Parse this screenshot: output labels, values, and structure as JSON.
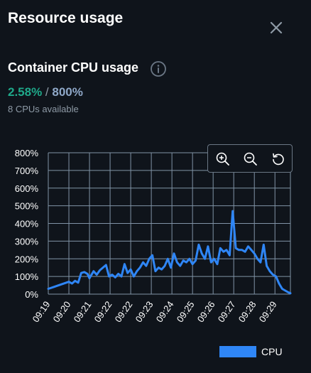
{
  "panel": {
    "title": "Resource usage"
  },
  "section": {
    "title": "Container CPU usage",
    "current_usage": "2.58%",
    "separator": " / ",
    "max_usage": "800%",
    "cpus_available": "8 CPUs available"
  },
  "icons": {
    "close": "close-icon",
    "info": "info-icon",
    "zoom_in": "zoom-in-icon",
    "zoom_out": "zoom-out-icon",
    "reset": "reset-zoom-icon"
  },
  "colors": {
    "background": "#0f141b",
    "series": "#2f86f6",
    "current_value": "#1fa98a",
    "grid": "#8093a6"
  },
  "chart_data": {
    "type": "line",
    "title": "",
    "xlabel": "",
    "ylabel": "",
    "ylim": [
      0,
      800
    ],
    "y_ticks": [
      "800%",
      "700%",
      "600%",
      "500%",
      "400%",
      "300%",
      "200%",
      "100%",
      "0%"
    ],
    "x_ticks": [
      "09:19",
      "09:20",
      "09:21",
      "09:22",
      "09:22",
      "09:23",
      "09:24",
      "09:25",
      "09:26",
      "09:27",
      "09:28",
      "09:29"
    ],
    "grid": true,
    "legend_position": "bottom-right",
    "series": [
      {
        "name": "CPU",
        "color": "#2f86f6",
        "x": [
          0.0,
          0.25,
          0.5,
          0.75,
          1.0,
          1.15,
          1.3,
          1.45,
          1.6,
          1.75,
          1.9,
          2.0,
          2.2,
          2.35,
          2.5,
          2.65,
          2.8,
          2.95,
          3.1,
          3.25,
          3.4,
          3.55,
          3.7,
          3.85,
          4.0,
          4.15,
          4.3,
          4.45,
          4.6,
          4.75,
          4.9,
          5.05,
          5.2,
          5.35,
          5.5,
          5.65,
          5.8,
          5.95,
          6.1,
          6.25,
          6.4,
          6.55,
          6.7,
          6.85,
          7.0,
          7.15,
          7.3,
          7.45,
          7.6,
          7.75,
          7.9,
          8.05,
          8.2,
          8.35,
          8.5,
          8.65,
          8.8,
          8.95,
          9.1,
          9.25,
          9.4,
          9.55,
          9.7,
          9.85,
          10.0,
          10.15,
          10.3,
          10.45,
          10.6,
          10.75,
          10.9,
          11.05,
          11.2,
          11.35,
          11.5,
          11.65,
          11.75
        ],
        "y": [
          30,
          40,
          50,
          60,
          70,
          60,
          75,
          65,
          120,
          125,
          115,
          90,
          130,
          110,
          135,
          150,
          165,
          100,
          110,
          95,
          115,
          100,
          170,
          120,
          140,
          100,
          130,
          150,
          180,
          160,
          200,
          220,
          130,
          150,
          140,
          160,
          200,
          150,
          230,
          180,
          160,
          190,
          180,
          200,
          170,
          190,
          280,
          230,
          200,
          270,
          180,
          200,
          170,
          260,
          240,
          250,
          220,
          470,
          260,
          250,
          250,
          240,
          270,
          250,
          230,
          200,
          180,
          280,
          160,
          130,
          110,
          100,
          60,
          30,
          20,
          10,
          5
        ]
      }
    ]
  },
  "legend": {
    "label": "CPU"
  }
}
